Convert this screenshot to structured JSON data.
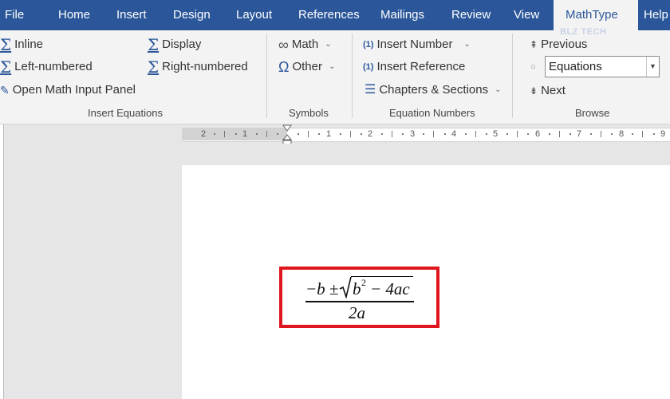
{
  "tabs": [
    {
      "label": "File"
    },
    {
      "label": "Home"
    },
    {
      "label": "Insert"
    },
    {
      "label": "Design"
    },
    {
      "label": "Layout"
    },
    {
      "label": "References"
    },
    {
      "label": "Mailings"
    },
    {
      "label": "Review"
    },
    {
      "label": "View"
    },
    {
      "label": "MathType"
    },
    {
      "label": "Help"
    }
  ],
  "active_tab": "MathType",
  "ribbon": {
    "insert_equations": {
      "inline": "Inline",
      "display": "Display",
      "left_numbered": "Left-numbered",
      "right_numbered": "Right-numbered",
      "open_panel": "Open Math Input Panel",
      "group_label": "Insert Equations"
    },
    "symbols": {
      "math": "Math",
      "other": "Other",
      "group_label": "Symbols"
    },
    "equation_numbers": {
      "insert_number": "Insert Number",
      "insert_number_icon": "(1)",
      "insert_reference": "Insert Reference",
      "insert_reference_icon": "(1)",
      "chapters_sections": "Chapters & Sections",
      "group_label": "Equation Numbers"
    },
    "browse": {
      "previous": "Previous",
      "equations_select": "Equations",
      "next": "Next",
      "group_label": "Browse"
    },
    "watermark": "BLZ TECH"
  },
  "ruler": {
    "left_labels": [
      "2",
      "1"
    ],
    "right_labels": [
      "1",
      "2",
      "3",
      "4",
      "5",
      "6",
      "7",
      "8",
      "9"
    ]
  },
  "equation": {
    "numerator_neg_b": "−b ±",
    "radicand": "b",
    "exponent": "2",
    "radicand_rest": "− 4ac",
    "denominator": "2a"
  },
  "colors": {
    "tab_bar": "#2b579a",
    "ribbon_bg": "#f3f3f3",
    "highlight_frame": "#e0161f"
  }
}
